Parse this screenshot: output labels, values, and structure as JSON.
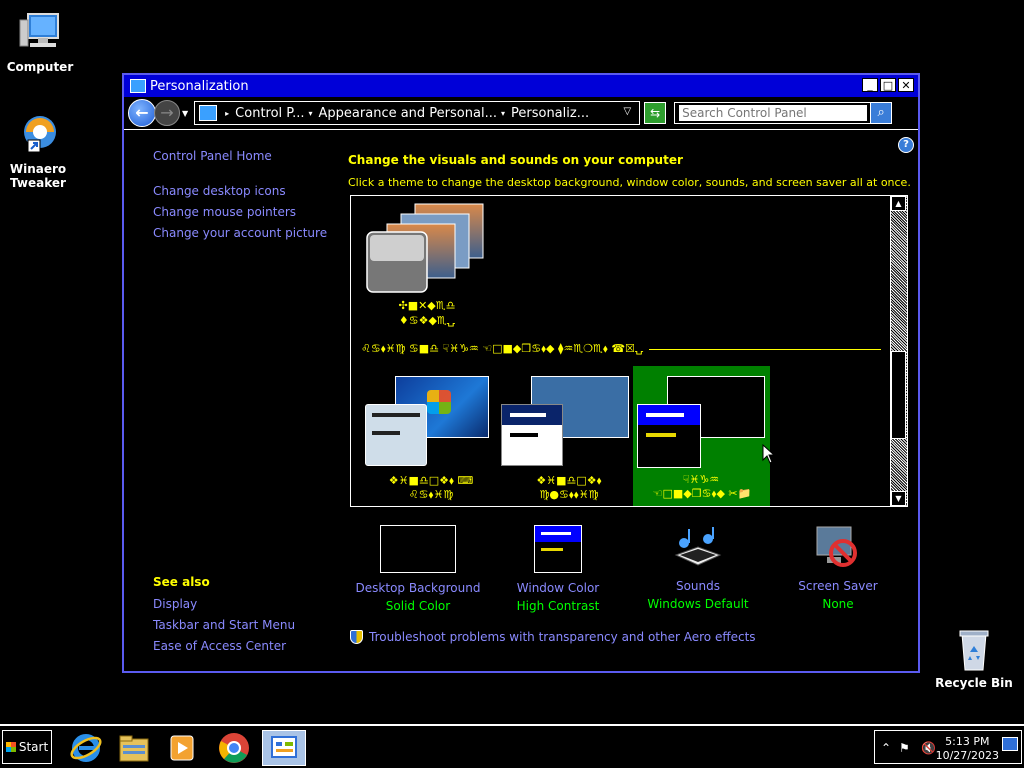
{
  "desktop": {
    "icons": [
      {
        "label": "Computer"
      },
      {
        "label": "Winaero Tweaker"
      },
      {
        "label": "Recycle Bin"
      }
    ]
  },
  "window": {
    "title": "Personalization",
    "address": {
      "crumbs": [
        "Control P...",
        "Appearance and Personal...",
        "Personaliz..."
      ]
    },
    "search": {
      "placeholder": "Search Control Panel"
    },
    "left": {
      "home": "Control Panel Home",
      "links": [
        "Change desktop icons",
        "Change mouse pointers",
        "Change your account picture"
      ],
      "see_also_title": "See also",
      "see_also": [
        "Display",
        "Taskbar and Start Menu",
        "Ease of Access Center"
      ]
    },
    "main": {
      "heading": "Change the visuals and sounds on your computer",
      "subheading": "Click a theme to change the desktop background, window color, sounds, and screen saver all at once.",
      "my_theme_glyphs_1": "✣■✕◆♏♎",
      "my_theme_glyphs_2": "♦♋❖◆♏⍽",
      "group_header_glyphs": "♌♋⬧♓♍ ♋■♎ ☟♓♑♒ ☜□■◆❒♋⬧◆ ⧫♒♏❍♏⬧ ☎☒⍽",
      "themes": [
        {
          "line1": "❖♓■♎□❖⬧ ⌨",
          "line2": "♌♋⬧♓♍"
        },
        {
          "line1": "❖♓■♎□❖⬧",
          "line2": "♍●♋⬧⬧♓♍"
        },
        {
          "line1": "☟♓♑♒",
          "line2": "☜□■◆❒♋⬧◆ ✂📁"
        }
      ],
      "selected_theme_color": "#008000"
    },
    "bottom": {
      "items": [
        {
          "label": "Desktop Background",
          "value": "Solid Color"
        },
        {
          "label": "Window Color",
          "value": "High Contrast"
        },
        {
          "label": "Sounds",
          "value": "Windows Default"
        },
        {
          "label": "Screen Saver",
          "value": "None"
        }
      ],
      "troubleshoot": "Troubleshoot problems with transparency and other Aero effects"
    }
  },
  "taskbar": {
    "start_label": "Start",
    "time": "5:13 PM",
    "date": "10/27/2023",
    "apps": [
      "internet-explorer-icon",
      "file-explorer-icon",
      "media-player-icon",
      "chrome-icon",
      "control-panel-icon"
    ]
  },
  "colors": {
    "link": "#8a8aff",
    "heading": "#ffff00",
    "value": "#00ff00",
    "titlebar": "#0000d8"
  }
}
